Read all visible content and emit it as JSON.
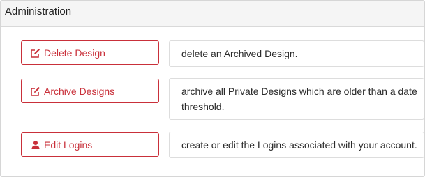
{
  "panel": {
    "title": "Administration"
  },
  "actions": [
    {
      "label": "Delete Design",
      "icon": "edit-icon",
      "description": "delete an Archived Design."
    },
    {
      "label": "Archive Designs",
      "icon": "edit-icon",
      "description": "archive all Private Designs which are older than a date threshold."
    },
    {
      "label": "Edit Logins",
      "icon": "user-icon",
      "description": "create or edit the Logins associated with your account."
    }
  ],
  "colors": {
    "accent": "#c9303a",
    "header_bg": "#f5f5f5",
    "border": "#d6d6d6"
  }
}
